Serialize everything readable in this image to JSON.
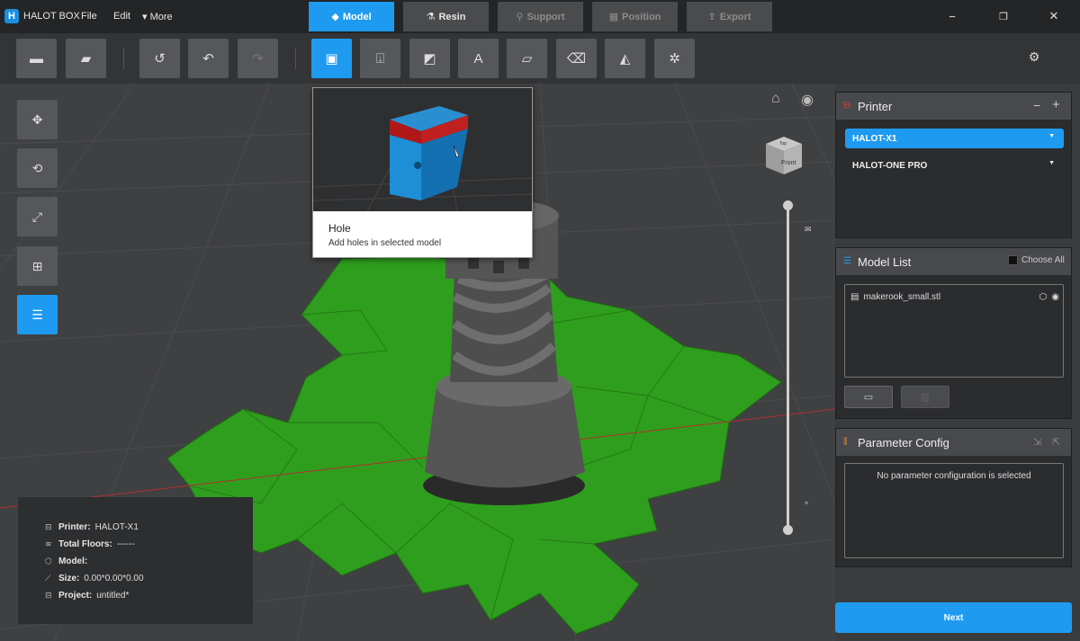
{
  "titlebar": {
    "app_name": "HALOT BOX",
    "menus": [
      "File",
      "Edit",
      "More"
    ],
    "steps": [
      "Model",
      "Resin",
      "Support",
      "Position",
      "Export"
    ],
    "window": {
      "minimize": "−",
      "restore": "❐",
      "close": "✕"
    }
  },
  "tooltip": {
    "title": "Hole",
    "desc": "Add holes in selected model"
  },
  "viewcube": {
    "top": "Top",
    "front": "Front"
  },
  "info": {
    "printer_label": "Printer:",
    "printer_value": "HALOT-X1",
    "floors_label": "Total Floors:",
    "floors_value": "------",
    "model_label": "Model:",
    "model_value": "",
    "size_label": "Size:",
    "size_value": "0.00*0.00*0.00",
    "project_label": "Project:",
    "project_value": "untitled*"
  },
  "printer_panel": {
    "title": "Printer",
    "selected": "HALOT-X1",
    "option": "HALOT-ONE PRO"
  },
  "model_panel": {
    "title": "Model List",
    "choose_all": "Choose All",
    "files": [
      "makerook_small.stl"
    ]
  },
  "param_panel": {
    "title": "Parameter Config",
    "empty": "No parameter configuration is selected"
  },
  "next_label": "Next",
  "colors": {
    "accent": "#1e9bf0",
    "plate": "#2f9e1e",
    "model": "#555555"
  }
}
